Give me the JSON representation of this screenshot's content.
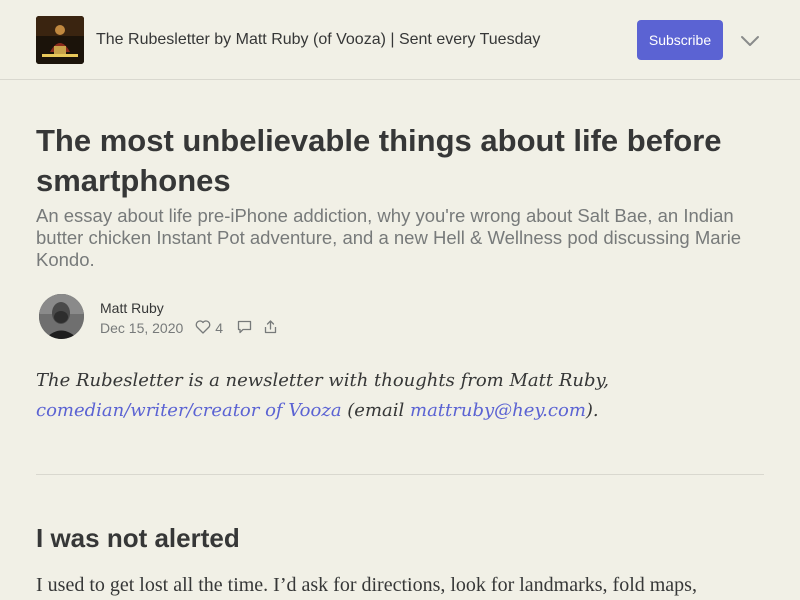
{
  "header": {
    "publication_title": "The Rubesletter by Matt Ruby (of Vooza) | Sent every Tuesday",
    "subscribe_label": "Subscribe",
    "menu_icon": "chevron-down-icon",
    "accent_color": "#5b63d3"
  },
  "post": {
    "title": "The most unbelievable things about life before smartphones",
    "subtitle": "An essay about life pre-iPhone addiction, why you're wrong about Salt Bae, an Indian butter chicken Instant Pot adventure, and a new Hell & Wellness pod discussing Marie Kondo.",
    "author": "Matt Ruby",
    "date": "Dec 15, 2020",
    "likes": "4",
    "icons": [
      "heart-icon",
      "comment-icon",
      "share-icon"
    ]
  },
  "intro": {
    "text_before": "The Rubesletter is a newsletter with thoughts from Matt Ruby, ",
    "link1": "comedian/writer/creator of Vooza",
    "text_middle": " (email ",
    "link2": "mattruby@hey.com",
    "text_after": ")."
  },
  "section": {
    "heading": "I was not alerted",
    "first_line": "I used to get lost all the time. I’d ask for directions, look for landmarks, fold maps,"
  }
}
